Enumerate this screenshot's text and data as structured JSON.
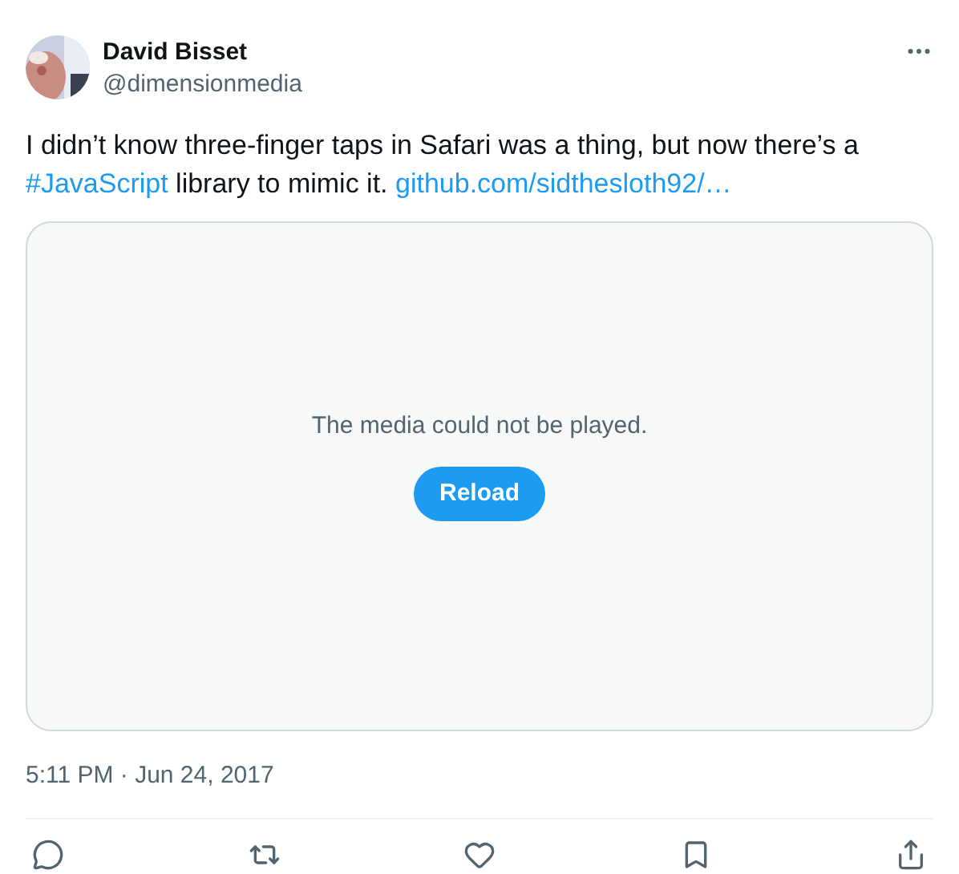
{
  "author": {
    "name": "David Bisset",
    "handle": "@dimensionmedia"
  },
  "tweet": {
    "text_before": "I didn’t know three-finger taps in Safari was a thing, but now there’s a ",
    "hashtag": "#JavaScript",
    "text_after": " library to mimic it. ",
    "link": "github.com/sidthesloth92/…"
  },
  "media": {
    "message": "The media could not be played.",
    "button": "Reload"
  },
  "timestamp": "5:11 PM · Jun 24, 2017",
  "actions": [
    {
      "kind": "reply"
    },
    {
      "kind": "repost"
    },
    {
      "kind": "like"
    },
    {
      "kind": "bookmark"
    },
    {
      "kind": "share"
    }
  ]
}
